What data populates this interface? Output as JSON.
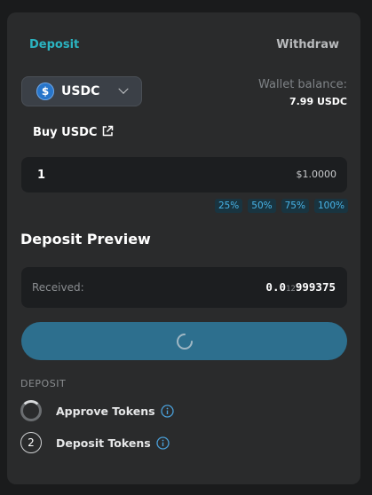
{
  "tabs": {
    "deposit": "Deposit",
    "withdraw": "Withdraw"
  },
  "token": {
    "symbol": "USDC",
    "icon": "usdc-coin-icon",
    "icon_glyph": "$"
  },
  "wallet": {
    "label": "Wallet balance:",
    "value": "7.99 USDC"
  },
  "buy": {
    "label": "Buy USDC"
  },
  "amount": {
    "value": "1",
    "usd_value": "$1.0000"
  },
  "percent_options": [
    "25%",
    "50%",
    "75%",
    "100%"
  ],
  "preview": {
    "title": "Deposit Preview",
    "received_label": "Received:",
    "received_prefix": "0.0",
    "received_zero_count": "12",
    "received_digits": "999375"
  },
  "action_button": {
    "state": "loading"
  },
  "steps_section": {
    "title": "DEPOSIT",
    "steps": [
      {
        "label": "Approve Tokens",
        "status": "in-progress"
      },
      {
        "number": "2",
        "label": "Deposit Tokens",
        "status": "pending"
      }
    ]
  },
  "colors": {
    "accent": "#2bb3c0",
    "button": "#2d6f8e",
    "percent_text": "#48b4e8",
    "card": "#2a2b2c"
  }
}
